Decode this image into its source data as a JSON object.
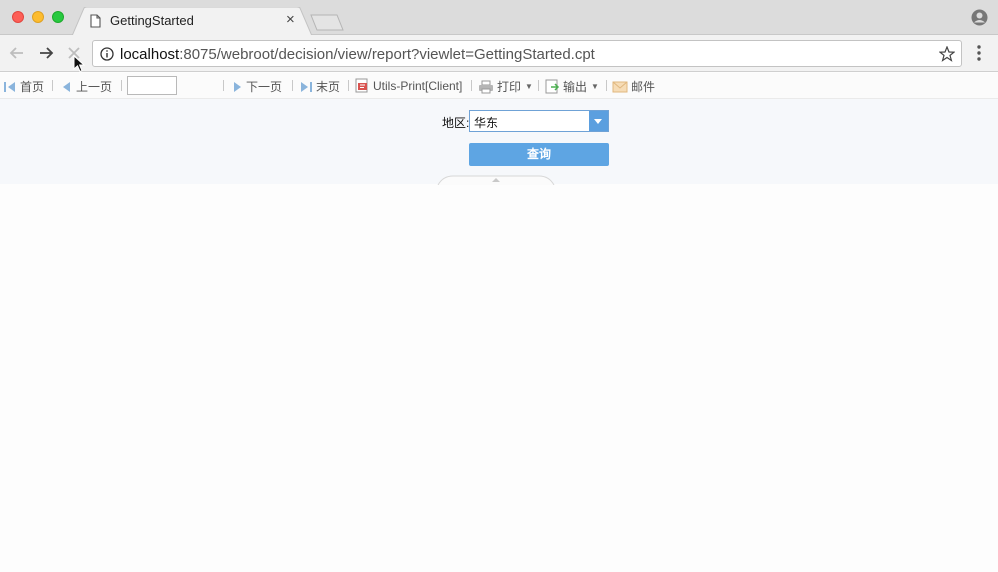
{
  "browser": {
    "tab_title": "GettingStarted",
    "tab_close": "×",
    "url_host": "localhost",
    "url_rest": ":8075/webroot/decision/view/report?viewlet=GettingStarted.cpt"
  },
  "report_toolbar": {
    "first_page": "首页",
    "prev_page": "上一页",
    "page_number_value": "",
    "next_page": "下一页",
    "last_page": "末页",
    "utils_print": "Utils-Print[Client]",
    "print": "打印",
    "export": "输出",
    "email": "邮件"
  },
  "parameter_pane": {
    "region_label": "地区:",
    "region_value": "华东",
    "query_button": "查询"
  },
  "colors": {
    "accent": "#5ea5e3",
    "combo_border": "#6fa2d6"
  }
}
